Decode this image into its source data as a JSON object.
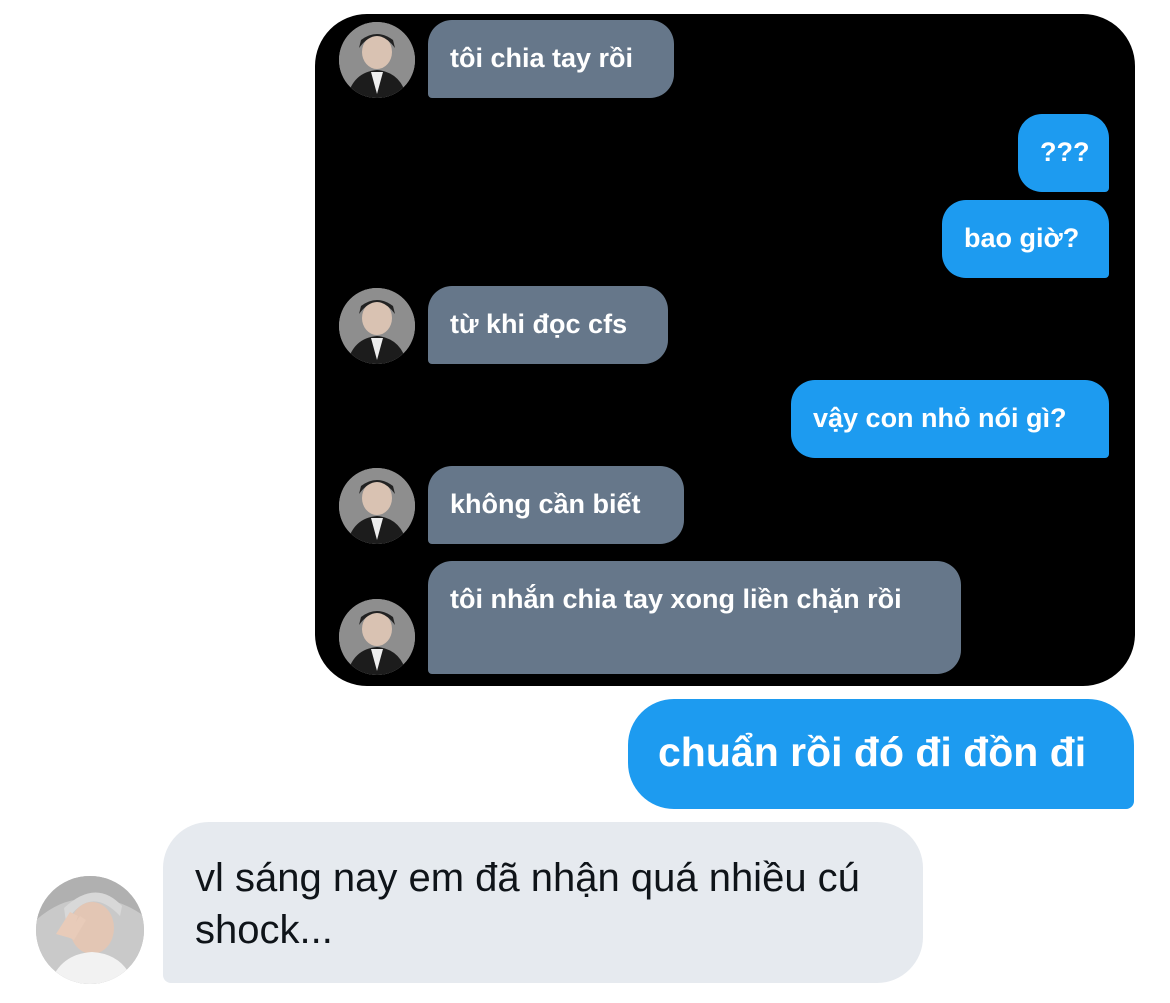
{
  "screenshot": {
    "messages": [
      {
        "from": "them",
        "text": "tôi chia tay rồi"
      },
      {
        "from": "me",
        "text": "???"
      },
      {
        "from": "me",
        "text": "bao giờ?"
      },
      {
        "from": "them",
        "text": "từ khi đọc cfs"
      },
      {
        "from": "me",
        "text": "vậy con nhỏ nói gì?"
      },
      {
        "from": "them",
        "text": "không cần biết"
      },
      {
        "from": "them",
        "text": "tôi nhắn chia tay xong liền chặn rồi"
      }
    ]
  },
  "chat": {
    "outgoing": "chuẩn rồi đó đi đồn đi",
    "incoming": "vl sáng nay em đã nhận quá nhiều cú shock..."
  },
  "colors": {
    "outgoing_bubble": "#1d9bf0",
    "screenshot_incoming_bubble": "#66778a",
    "incoming_bubble": "#e6eaef",
    "screenshot_background": "#000000"
  },
  "icons": {
    "avatar_screenshot": "profile-photo-avatar",
    "avatar_chat": "profile-photo-avatar"
  }
}
